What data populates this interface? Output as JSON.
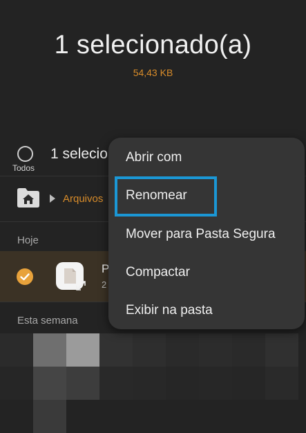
{
  "header": {
    "title": "1 selecionado(a)",
    "size": "54,43 KB"
  },
  "selection_bar": {
    "select_all_label": "Todos",
    "count_label": "1 selecio"
  },
  "breadcrumb": {
    "label": "Arquivos"
  },
  "sections": {
    "today": "Hoje",
    "this_week": "Esta semana"
  },
  "selected_file": {
    "name": "P",
    "meta": "2",
    "selected": true
  },
  "context_menu": {
    "items": [
      {
        "label": "Abrir com"
      },
      {
        "label": "Renomear",
        "highlighted": true
      },
      {
        "label": "Mover para Pasta Segura"
      },
      {
        "label": "Compactar"
      },
      {
        "label": "Exibir na pasta"
      }
    ]
  },
  "colors": {
    "background": "#232323",
    "accent_orange": "#d88c2a",
    "selected_row": "#3b3225",
    "menu_background": "#353535",
    "highlight_blue": "#1b97d5"
  },
  "icons": {
    "home_folder": "home-folder-icon",
    "check": "check-circle-icon",
    "file": "file-icon",
    "expand": "expand-icon"
  }
}
